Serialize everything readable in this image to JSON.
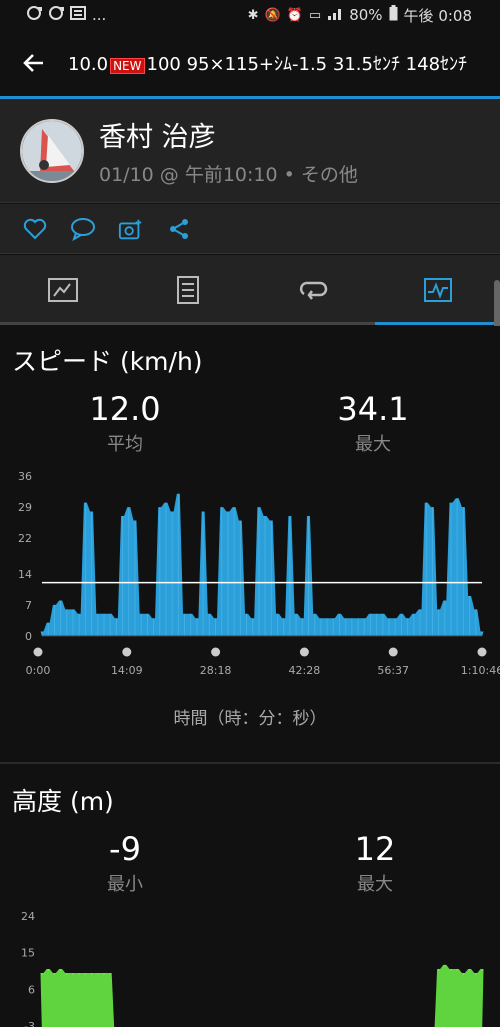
{
  "status": {
    "left_icons": [
      "sync-icon",
      "sync-icon",
      "news-icon"
    ],
    "ellipsis": "...",
    "battery": "80%",
    "time": "午後 0:08"
  },
  "appbar": {
    "title_pre": "10.0",
    "badge": "NEW",
    "title_post": "100 95×115+ｼﾑ-1.5 31.5ｾﾝﾁ 148ｾﾝﾁ"
  },
  "profile": {
    "name": "香村 治彦",
    "meta": "01/10 @ 午前10:10 • その他"
  },
  "speed": {
    "title": "スピード (km/h)",
    "avg_value": "12.0",
    "avg_label": "平均",
    "max_value": "34.1",
    "max_label": "最大",
    "x_caption": "時間（時：分：秒）"
  },
  "altitude": {
    "title": "高度 (m)",
    "min_value": "-9",
    "min_label": "最小",
    "max_value": "12",
    "max_label": "最大"
  },
  "colors": {
    "accent": "#1f8fd2",
    "speed_fill": "#2a9fd9",
    "alt_fill": "#5fd43f"
  },
  "chart_data": [
    {
      "type": "area",
      "title": "スピード (km/h)",
      "xlabel": "時間（時：分：秒）",
      "ylabel": "",
      "ylim": [
        0,
        36
      ],
      "yticks": [
        "0",
        "7",
        "14",
        "22",
        "29",
        "36"
      ],
      "xticks": [
        "0:00",
        "14:09",
        "28:18",
        "42:28",
        "56:37",
        "1:10:46"
      ],
      "average_line": 12.0,
      "x": [
        0,
        1,
        2,
        3,
        4,
        5,
        6,
        7,
        8,
        9,
        10,
        11,
        12,
        13,
        14,
        15,
        16,
        17,
        18,
        19,
        20,
        21,
        22,
        23,
        24,
        25,
        26,
        27,
        28,
        29,
        30,
        31,
        32,
        33,
        34,
        35,
        36,
        37,
        38,
        39,
        40,
        41,
        42,
        43,
        44,
        45,
        46,
        47,
        48,
        49,
        50,
        51,
        52,
        53,
        54,
        55,
        56,
        57,
        58,
        59,
        60,
        61,
        62,
        63,
        64,
        65,
        66,
        67,
        68,
        69,
        70,
        71
      ],
      "values": [
        1,
        3,
        7,
        8,
        6,
        6,
        5,
        30,
        28,
        5,
        5,
        5,
        4,
        27,
        29,
        26,
        5,
        5,
        4,
        29,
        30,
        28,
        32,
        5,
        5,
        4,
        28,
        5,
        4,
        29,
        28,
        29,
        26,
        5,
        4,
        29,
        27,
        26,
        5,
        4,
        27,
        5,
        4,
        27,
        5,
        4,
        4,
        4,
        5,
        4,
        4,
        4,
        4,
        5,
        5,
        5,
        4,
        4,
        5,
        4,
        5,
        6,
        30,
        29,
        6,
        8,
        30,
        31,
        29,
        9,
        6,
        1
      ]
    },
    {
      "type": "area",
      "title": "高度 (m)",
      "ylim": [
        -3,
        24
      ],
      "yticks": [
        "-3",
        "6",
        "15",
        "24"
      ],
      "x": [
        0,
        1,
        2,
        3,
        4,
        5,
        6,
        7,
        8,
        9,
        10,
        11,
        12,
        13,
        14,
        15,
        16,
        17,
        18,
        19,
        20,
        21,
        22,
        23,
        24,
        25,
        26,
        27,
        28,
        29,
        30,
        31,
        32,
        33,
        34,
        35,
        36,
        37,
        38,
        39,
        40,
        41,
        42,
        43,
        44,
        45,
        46,
        47,
        48,
        49,
        50,
        51,
        52,
        53,
        54,
        55,
        56,
        57,
        58,
        59,
        60,
        61,
        62,
        63,
        64,
        65,
        66,
        67,
        68,
        69,
        70,
        71
      ],
      "values": [
        10,
        11,
        10,
        11,
        10,
        10,
        10,
        10,
        10,
        10,
        10,
        10,
        -7,
        -7,
        -6,
        -7,
        -6,
        -7,
        -6,
        -6,
        -7,
        -6,
        -7,
        -6,
        -6,
        -7,
        -6,
        -7,
        -6,
        -6,
        -7,
        -6,
        -7,
        -6,
        -7,
        -6,
        -6,
        -7,
        -6,
        -7,
        -6,
        -6,
        -7,
        -6,
        -7,
        -6,
        -6,
        -7,
        -6,
        -7,
        -6,
        -6,
        -7,
        -6,
        -7,
        -6,
        -6,
        -7,
        -6,
        -7,
        -6,
        -7,
        -6,
        -7,
        11,
        12,
        11,
        11,
        10,
        11,
        10,
        11
      ]
    }
  ]
}
